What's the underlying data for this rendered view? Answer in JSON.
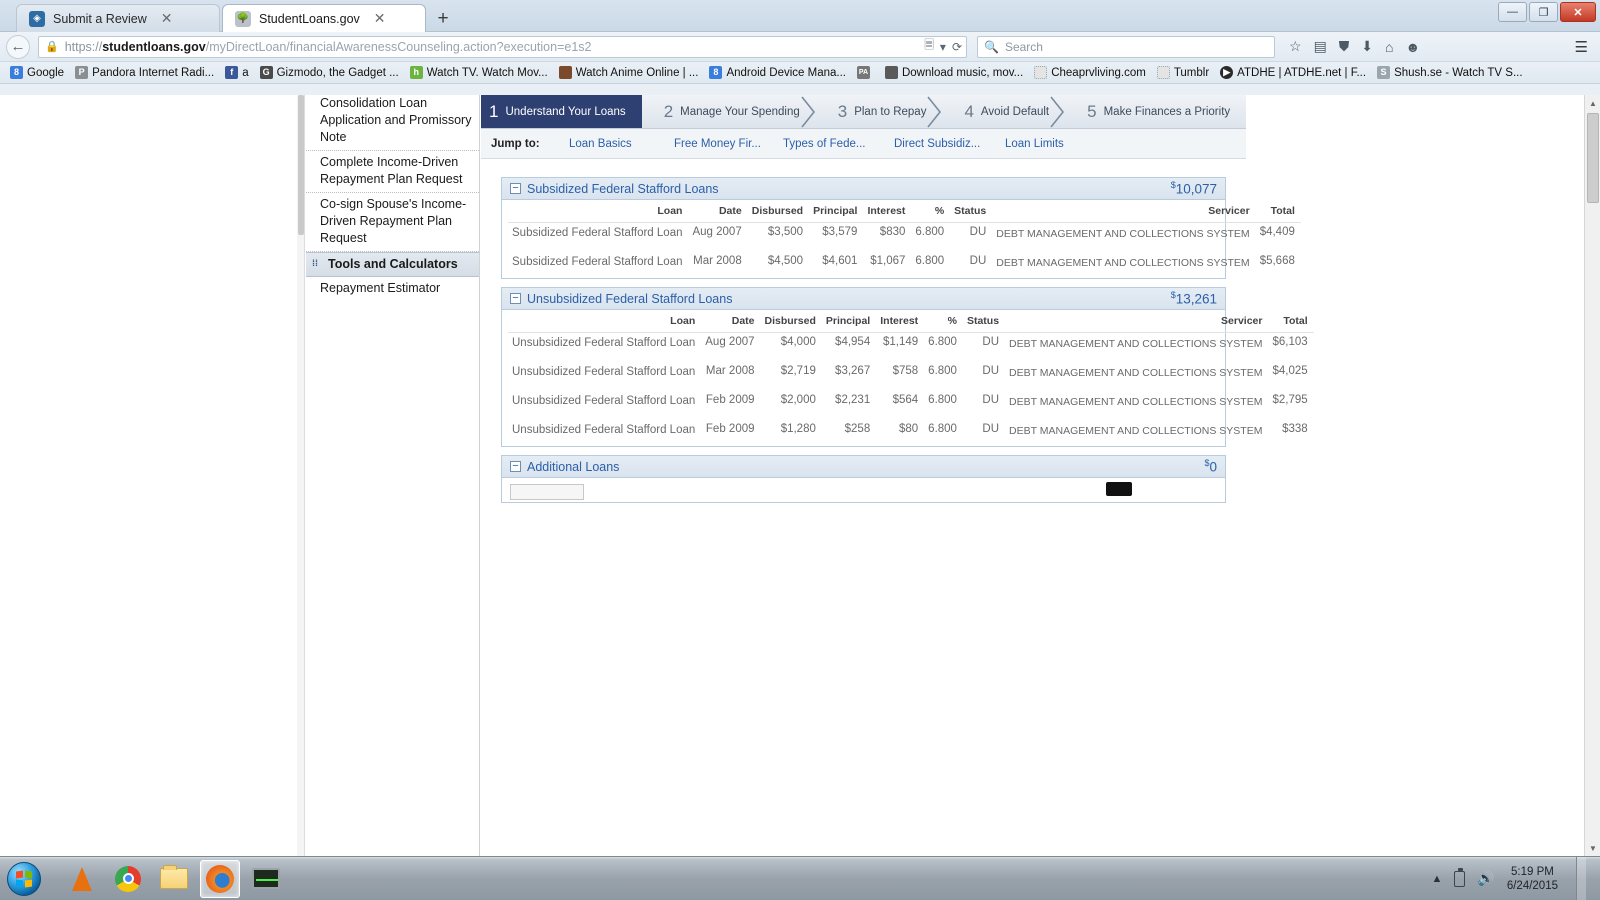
{
  "window": {
    "controls": {
      "minimize": "—",
      "restore": "❐",
      "close": "✕"
    }
  },
  "browser": {
    "tabs": [
      {
        "title": "Submit a Review",
        "favicon": "shield-icon",
        "active": false,
        "close": "✕"
      },
      {
        "title": "StudentLoans.gov",
        "favicon": "tree-icon",
        "active": true,
        "close": "✕"
      }
    ],
    "new_tab_label": "+",
    "url": {
      "scheme": "https://",
      "domain": "studentloans.gov",
      "path": "/myDirectLoan/financialAwarenessCounseling.action?execution=e1s2",
      "lock_icon": "lock-icon"
    },
    "search_placeholder": "Search",
    "toolbar_icons": [
      "reader-icon",
      "chevron-down-icon",
      "reload-icon",
      "bookmark-star-icon",
      "reading-list-icon",
      "pocket-icon",
      "downloads-icon",
      "home-icon",
      "feedback-icon",
      "menu-icon"
    ],
    "bookmarks": [
      {
        "label": "Google",
        "icon": "google-icon",
        "icon_class": "ic-g",
        "glyph": "8"
      },
      {
        "label": "Pandora Internet Radi...",
        "icon": "pandora-icon",
        "icon_class": "ic-p",
        "glyph": "P"
      },
      {
        "label": "a",
        "icon": "facebook-icon",
        "icon_class": "ic-fb",
        "glyph": "f"
      },
      {
        "label": "Gizmodo, the Gadget ...",
        "icon": "gizmodo-icon",
        "icon_class": "ic-gz",
        "glyph": "G"
      },
      {
        "label": "Watch TV. Watch Mov...",
        "icon": "hulu-icon",
        "icon_class": "ic-h",
        "glyph": "h"
      },
      {
        "label": "Watch Anime Online | ...",
        "icon": "anime-icon",
        "icon_class": "ic-an",
        "glyph": ""
      },
      {
        "label": "Android Device Mana...",
        "icon": "android-icon",
        "icon_class": "ic-8",
        "glyph": "8"
      },
      {
        "label": "",
        "icon": "pa-icon",
        "icon_class": "ic-pa",
        "glyph": "PA"
      },
      {
        "label": "Download music, mov...",
        "icon": "download-icon",
        "icon_class": "ic-dm",
        "glyph": ""
      },
      {
        "label": "Cheaprvliving.com",
        "icon": "blank-page-icon",
        "icon_class": "ic-blank",
        "glyph": ""
      },
      {
        "label": "Tumblr",
        "icon": "blank-page-icon",
        "icon_class": "ic-blank",
        "glyph": ""
      },
      {
        "label": "ATDHE | ATDHE.net | F...",
        "icon": "atdhe-icon",
        "icon_class": "ic-at",
        "glyph": "▶"
      },
      {
        "label": "Shush.se - Watch TV S...",
        "icon": "shush-icon",
        "icon_class": "ic-s",
        "glyph": "S"
      }
    ]
  },
  "sidebar": {
    "items": [
      {
        "label": "Consolidation Loan Application and Promissory Note",
        "type": "link",
        "clipped": true
      },
      {
        "label": "Complete Income-Driven Repayment Plan Request",
        "type": "link"
      },
      {
        "label": "Co-sign Spouse's Income-Driven Repayment Plan Request",
        "type": "link"
      },
      {
        "label": "Tools and Calculators",
        "type": "section"
      },
      {
        "label": "Repayment Estimator",
        "type": "link"
      }
    ]
  },
  "steps": [
    {
      "num": "1",
      "label": "Understand Your Loans",
      "active": true
    },
    {
      "num": "2",
      "label": "Manage Your Spending",
      "active": false
    },
    {
      "num": "3",
      "label": "Plan to Repay",
      "active": false
    },
    {
      "num": "4",
      "label": "Avoid Default",
      "active": false
    },
    {
      "num": "5",
      "label": "Make Finances a Priority",
      "active": false
    }
  ],
  "jump_to": {
    "label": "Jump to:",
    "links": [
      "Loan Basics",
      "Free Money Fir...",
      "Types of Fede...",
      "Direct Subsidiz...",
      "Loan Limits"
    ]
  },
  "table_headers": [
    "Loan",
    "Date",
    "Disbursed",
    "Principal",
    "Interest",
    "%",
    "Status",
    "Servicer",
    "Total"
  ],
  "panels": [
    {
      "title": "Subsidized Federal Stafford Loans",
      "total": "10,077",
      "currency": "$",
      "toggle": "−",
      "rows": [
        {
          "loan": "Subsidized Federal Stafford Loan",
          "date": "Aug 2007",
          "disbursed": "$3,500",
          "principal": "$3,579",
          "interest": "$830",
          "pct": "6.800",
          "status": "DU",
          "servicer": "DEBT MANAGEMENT AND COLLECTIONS SYSTEM",
          "total": "$4,409"
        },
        {
          "loan": "Subsidized Federal Stafford Loan",
          "date": "Mar 2008",
          "disbursed": "$4,500",
          "principal": "$4,601",
          "interest": "$1,067",
          "pct": "6.800",
          "status": "DU",
          "servicer": "DEBT MANAGEMENT AND COLLECTIONS SYSTEM",
          "total": "$5,668"
        }
      ]
    },
    {
      "title": "Unsubsidized Federal Stafford Loans",
      "total": "13,261",
      "currency": "$",
      "toggle": "−",
      "rows": [
        {
          "loan": "Unsubsidized Federal Stafford Loan",
          "date": "Aug 2007",
          "disbursed": "$4,000",
          "principal": "$4,954",
          "interest": "$1,149",
          "pct": "6.800",
          "status": "DU",
          "servicer": "DEBT MANAGEMENT AND COLLECTIONS SYSTEM",
          "total": "$6,103"
        },
        {
          "loan": "Unsubsidized Federal Stafford Loan",
          "date": "Mar 2008",
          "disbursed": "$2,719",
          "principal": "$3,267",
          "interest": "$758",
          "pct": "6.800",
          "status": "DU",
          "servicer": "DEBT MANAGEMENT AND COLLECTIONS SYSTEM",
          "total": "$4,025"
        },
        {
          "loan": "Unsubsidized Federal Stafford Loan",
          "date": "Feb 2009",
          "disbursed": "$2,000",
          "principal": "$2,231",
          "interest": "$564",
          "pct": "6.800",
          "status": "DU",
          "servicer": "DEBT MANAGEMENT AND COLLECTIONS SYSTEM",
          "total": "$2,795"
        },
        {
          "loan": "Unsubsidized Federal Stafford Loan",
          "date": "Feb 2009",
          "disbursed": "$1,280",
          "principal": "$258",
          "interest": "$80",
          "pct": "6.800",
          "status": "DU",
          "servicer": "DEBT MANAGEMENT AND COLLECTIONS SYSTEM",
          "total": "$338"
        }
      ]
    }
  ],
  "additional_loans": {
    "title": "Additional Loans",
    "total": "0",
    "currency": "$",
    "toggle": "−"
  },
  "taskbar": {
    "start_label": "Start",
    "items": [
      "vlc-icon",
      "chrome-icon",
      "explorer-icon",
      "firefox-icon",
      "monitor-icon"
    ],
    "tray_icons": [
      "show-hidden-icon",
      "battery-icon",
      "volume-icon"
    ],
    "time": "5:19 PM",
    "date": "6/24/2015"
  }
}
